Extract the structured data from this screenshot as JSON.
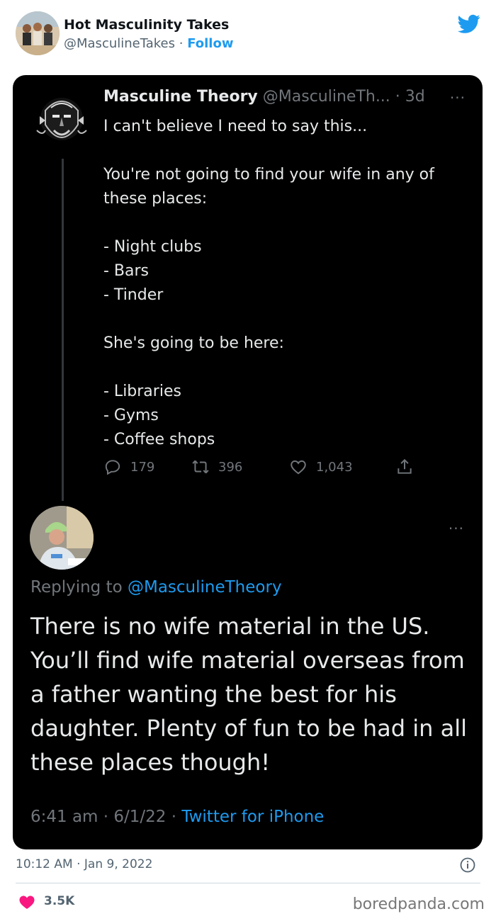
{
  "embed": {
    "author_name": "Hot Masculinity Takes",
    "author_handle": "@MasculineTakes",
    "separator": " · ",
    "follow_label": "Follow",
    "timestamp": "10:12 AM · Jan 9, 2022",
    "likes": "3.5K",
    "icons": {
      "brand": "twitter-bird-icon",
      "info": "info-icon",
      "like": "heart-icon"
    },
    "colors": {
      "accent": "#1d9bf0",
      "like": "#f91880"
    }
  },
  "original_tweet": {
    "name": "Masculine Theory",
    "handle": "@MasculineTh...",
    "age": " · 3d",
    "more": "···",
    "text": "I can't believe I need to say this...\n\nYou're not going to find your wife in any of these places:\n\n- Night clubs\n- Bars\n- Tinder\n\nShe's going to be here:\n\n- Libraries\n- Gyms\n- Coffee shops",
    "replies": "179",
    "retweets": "396",
    "likes": "1,043"
  },
  "reply_tweet": {
    "more": "···",
    "replying_prefix": "Replying to ",
    "replying_handle": "@MasculineTheory",
    "text": "There is no wife material in the US. You’ll find wife material overseas from a father wanting the best for his daughter. Plenty of fun to be had in all these places though!",
    "time_date": "6:41 am · 6/1/22 · ",
    "source": "Twitter for iPhone"
  },
  "watermark": "boredpanda.com"
}
